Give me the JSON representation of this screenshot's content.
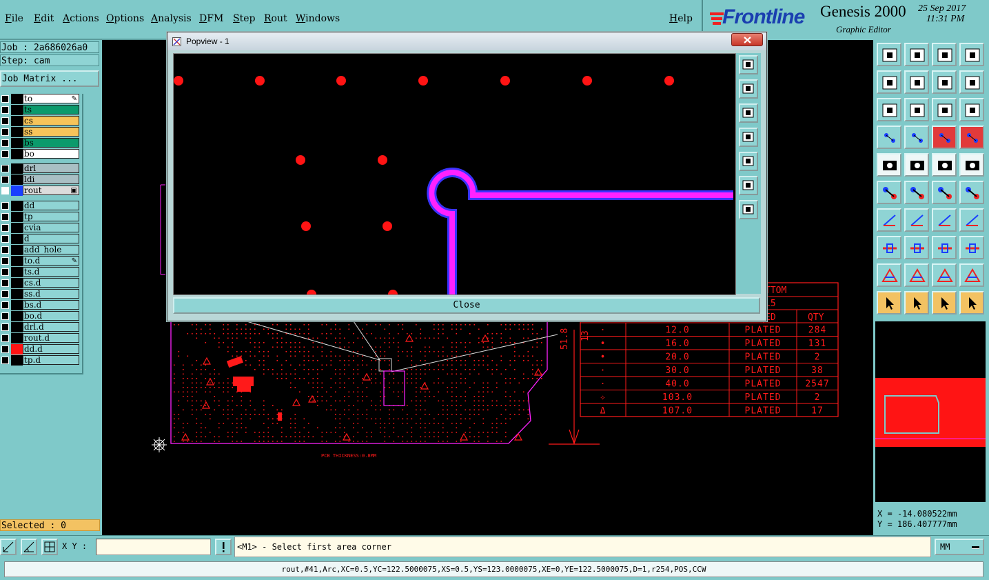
{
  "menu": {
    "items": [
      "File",
      "Edit",
      "Actions",
      "Options",
      "Analysis",
      "DFM",
      "Step",
      "Rout",
      "Windows"
    ],
    "help": "Help"
  },
  "brand": {
    "logo": "Frontline",
    "product": "Genesis 2000",
    "subtitle": "Graphic Editor",
    "date": "25 Sep 2017",
    "time": "11:31 PM"
  },
  "left": {
    "job": "Job : 2a686026a0",
    "step": "Step: cam",
    "matrix_button": "Job Matrix ...",
    "selected": "Selected : 0",
    "layers_group1": [
      {
        "name": "to",
        "color": "#ffffff",
        "mark": "✎"
      },
      {
        "name": "ts",
        "color": "#0b9a6c",
        "mark": ""
      },
      {
        "name": "cs",
        "color": "#f6c45a",
        "mark": ""
      },
      {
        "name": "ss",
        "color": "#f6c45a",
        "mark": ""
      },
      {
        "name": "bs",
        "color": "#0b9a6c",
        "mark": ""
      },
      {
        "name": "bo",
        "color": "#ffffff",
        "mark": ""
      }
    ],
    "layers_group2": [
      {
        "name": "drl",
        "color": "#a9bfc4",
        "mark": ""
      },
      {
        "name": "ldi",
        "color": "#a9bfc4",
        "mark": ""
      },
      {
        "name": "rout",
        "color": "#dcdcdc",
        "mark": "▣",
        "active": true
      }
    ],
    "layers_group3": [
      {
        "name": "dd",
        "color": "#8fd4d4",
        "mark": ""
      },
      {
        "name": "tp",
        "color": "#8fd4d4",
        "mark": ""
      },
      {
        "name": "cvia",
        "color": "#8fd4d4",
        "mark": ""
      },
      {
        "name": "d",
        "color": "#8fd4d4",
        "mark": ""
      },
      {
        "name": "add_hole",
        "color": "#8fd4d4",
        "mark": ""
      },
      {
        "name": "to.d",
        "color": "#8fd4d4",
        "mark": "✎"
      },
      {
        "name": "ts.d",
        "color": "#8fd4d4",
        "mark": ""
      },
      {
        "name": "cs.d",
        "color": "#8fd4d4",
        "mark": ""
      },
      {
        "name": "ss.d",
        "color": "#8fd4d4",
        "mark": ""
      },
      {
        "name": "bs.d",
        "color": "#8fd4d4",
        "mark": ""
      },
      {
        "name": "bo.d",
        "color": "#8fd4d4",
        "mark": ""
      },
      {
        "name": "drl.d",
        "color": "#8fd4d4",
        "mark": ""
      },
      {
        "name": "rout.d",
        "color": "#8fd4d4",
        "mark": ""
      },
      {
        "name": "dd.d",
        "color": "#8fd4d4",
        "mark": "",
        "red": true
      },
      {
        "name": "tp.d",
        "color": "#8fd4d4",
        "mark": ""
      }
    ]
  },
  "popup": {
    "title": "Popview - 1",
    "close_label": "Close"
  },
  "drill_table": {
    "header_partial": [
      "TTOM",
      "L5",
      "ED",
      "QTY"
    ],
    "rows": [
      {
        "sym": "·",
        "size": "12.0",
        "type": "PLATED",
        "qty": "284"
      },
      {
        "sym": "•",
        "size": "16.0",
        "type": "PLATED",
        "qty": "131"
      },
      {
        "sym": "•",
        "size": "20.0",
        "type": "PLATED",
        "qty": "2"
      },
      {
        "sym": "·",
        "size": "30.0",
        "type": "PLATED",
        "qty": "38"
      },
      {
        "sym": "·",
        "size": "40.0",
        "type": "PLATED",
        "qty": "2547"
      },
      {
        "sym": "✧",
        "size": "103.0",
        "type": "PLATED",
        "qty": "2"
      },
      {
        "sym": "Δ",
        "size": "107.0",
        "type": "PLATED",
        "qty": "17"
      }
    ],
    "dim_label": "51.8",
    "dim_label2": "13"
  },
  "board_note": "PCB THICKNESS:0.8MM",
  "coords": {
    "x": "X = -14.080522mm",
    "y": "Y = 186.407777mm"
  },
  "command": {
    "xy_label": "X Y :",
    "xy_value": "",
    "prompt": "<M1> - Select first area corner",
    "units": "MM"
  },
  "status": {
    "text": "rout,#41,Arc,XC=0.5,YC=122.5000075,XS=0.5,YS=123.0000075,XE=0,YE=122.5000075,D=1,r254,POS,CCW"
  },
  "colors": {
    "panel": "#7fc9c9",
    "button": "#8fd4d4",
    "pad_red": "#ff1414",
    "rout_magenta": "#ff22ff"
  }
}
